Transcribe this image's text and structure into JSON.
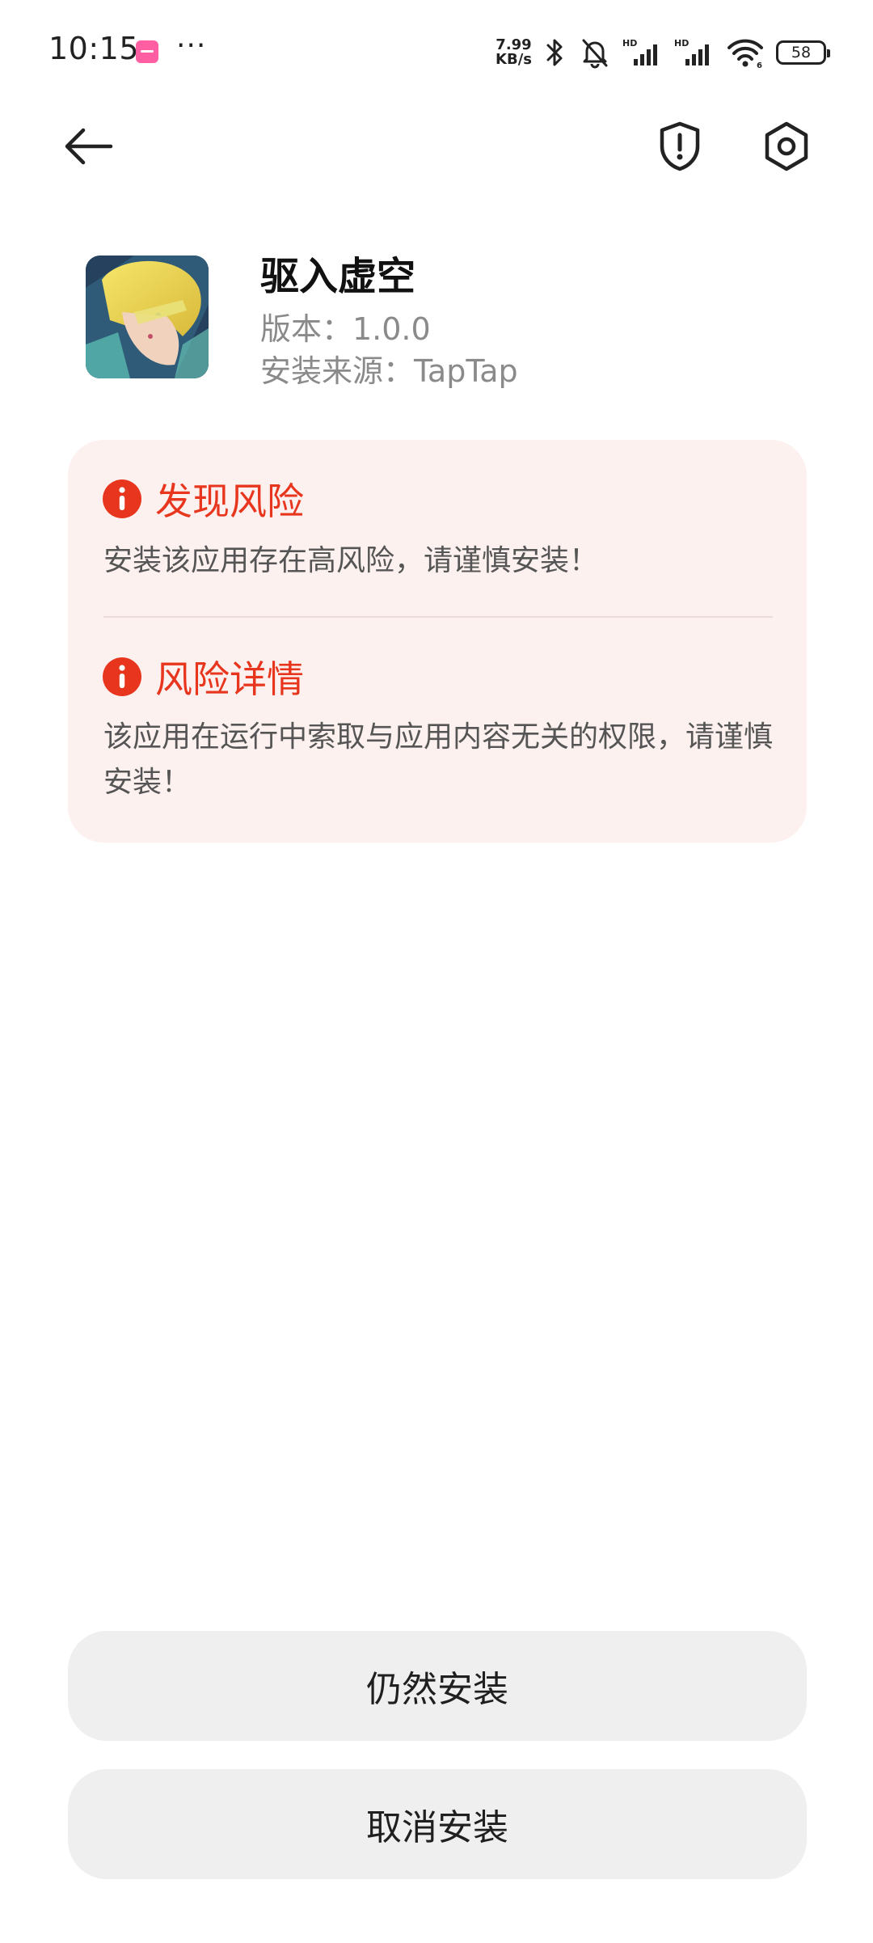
{
  "status_bar": {
    "time": "10:15",
    "more": "···",
    "net_speed_value": "7.99",
    "net_speed_unit": "KB/s",
    "battery": "58",
    "icons": [
      "notification-app-icon",
      "bluetooth-icon",
      "mute-icon",
      "signal-hd-icon",
      "signal-hd-icon",
      "wifi-icon",
      "battery-icon"
    ]
  },
  "toolbar": {
    "icons": [
      "back-arrow-icon",
      "shield-warning-icon",
      "settings-icon"
    ]
  },
  "app": {
    "name": "驱入虚空",
    "version": "版本：1.0.0",
    "source": "安装来源：TapTap"
  },
  "risk": {
    "found_title": "发现风险",
    "found_text": "安装该应用存在高风险，请谨慎安装！",
    "detail_title": "风险详情",
    "detail_text": "该应用在运行中索取与应用内容无关的权限，请谨慎安装！",
    "accent": "#e8361e",
    "card_bg": "#fdf1ef"
  },
  "actions": {
    "install_anyway": "仍然安装",
    "cancel_install": "取消安装"
  }
}
